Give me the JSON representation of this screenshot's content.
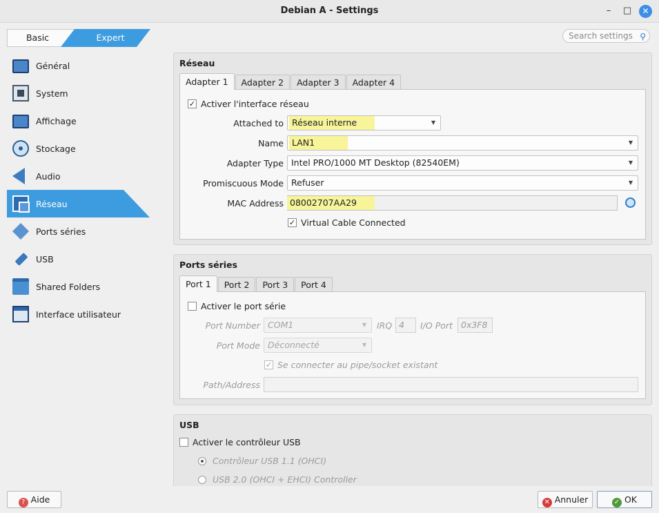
{
  "window": {
    "title": "Debian A - Settings",
    "minimize": "–",
    "maximize": "□",
    "close": "✕"
  },
  "mode": {
    "basic": "Basic",
    "expert": "Expert"
  },
  "search": {
    "placeholder": "Search settings"
  },
  "sidebar": {
    "items": [
      {
        "label": "Général",
        "icon": "general-icon"
      },
      {
        "label": "System",
        "icon": "system-icon"
      },
      {
        "label": "Affichage",
        "icon": "display-icon"
      },
      {
        "label": "Stockage",
        "icon": "storage-icon"
      },
      {
        "label": "Audio",
        "icon": "audio-icon"
      },
      {
        "label": "Réseau",
        "icon": "network-icon"
      },
      {
        "label": "Ports séries",
        "icon": "serial-ports-icon"
      },
      {
        "label": "USB",
        "icon": "usb-icon"
      },
      {
        "label": "Shared Folders",
        "icon": "shared-folders-icon"
      },
      {
        "label": "Interface utilisateur",
        "icon": "user-interface-icon"
      }
    ],
    "active": "Réseau"
  },
  "network": {
    "title": "Réseau",
    "tabs": [
      "Adapter 1",
      "Adapter 2",
      "Adapter 3",
      "Adapter 4"
    ],
    "enable_label": "Activer l'interface réseau",
    "attached_to_label": "Attached to",
    "attached_to_value": "Réseau interne",
    "name_label": "Name",
    "name_value": "LAN1",
    "adapter_type_label": "Adapter Type",
    "adapter_type_value": "Intel PRO/1000 MT Desktop (82540EM)",
    "promiscuous_label": "Promiscuous Mode",
    "promiscuous_value": "Refuser",
    "mac_label": "MAC Address",
    "mac_value": "08002707AA29",
    "cable_label": "Virtual Cable Connected"
  },
  "serial": {
    "title": "Ports séries",
    "tabs": [
      "Port 1",
      "Port 2",
      "Port 3",
      "Port 4"
    ],
    "enable_label": "Activer le port série",
    "port_number_label": "Port Number",
    "port_number_value": "COM1",
    "irq_label": "IRQ",
    "irq_value": "4",
    "io_port_label": "I/O Port",
    "io_port_value": "0x3F8",
    "port_mode_label": "Port Mode",
    "port_mode_value": "Déconnecté",
    "pipe_label": "Se connecter au pipe/socket existant",
    "path_label": "Path/Address"
  },
  "usb": {
    "title": "USB",
    "enable_label": "Activer le contrôleur USB",
    "option_1": "Contrôleur USB 1.1 (OHCI)",
    "option_2": "USB 2.0 (OHCI + EHCI) Controller"
  },
  "buttons": {
    "help": "Aide",
    "cancel": "Annuler",
    "ok": "OK"
  },
  "colors": {
    "accent": "#3d9bdf",
    "highlight": "#f7f49a"
  }
}
